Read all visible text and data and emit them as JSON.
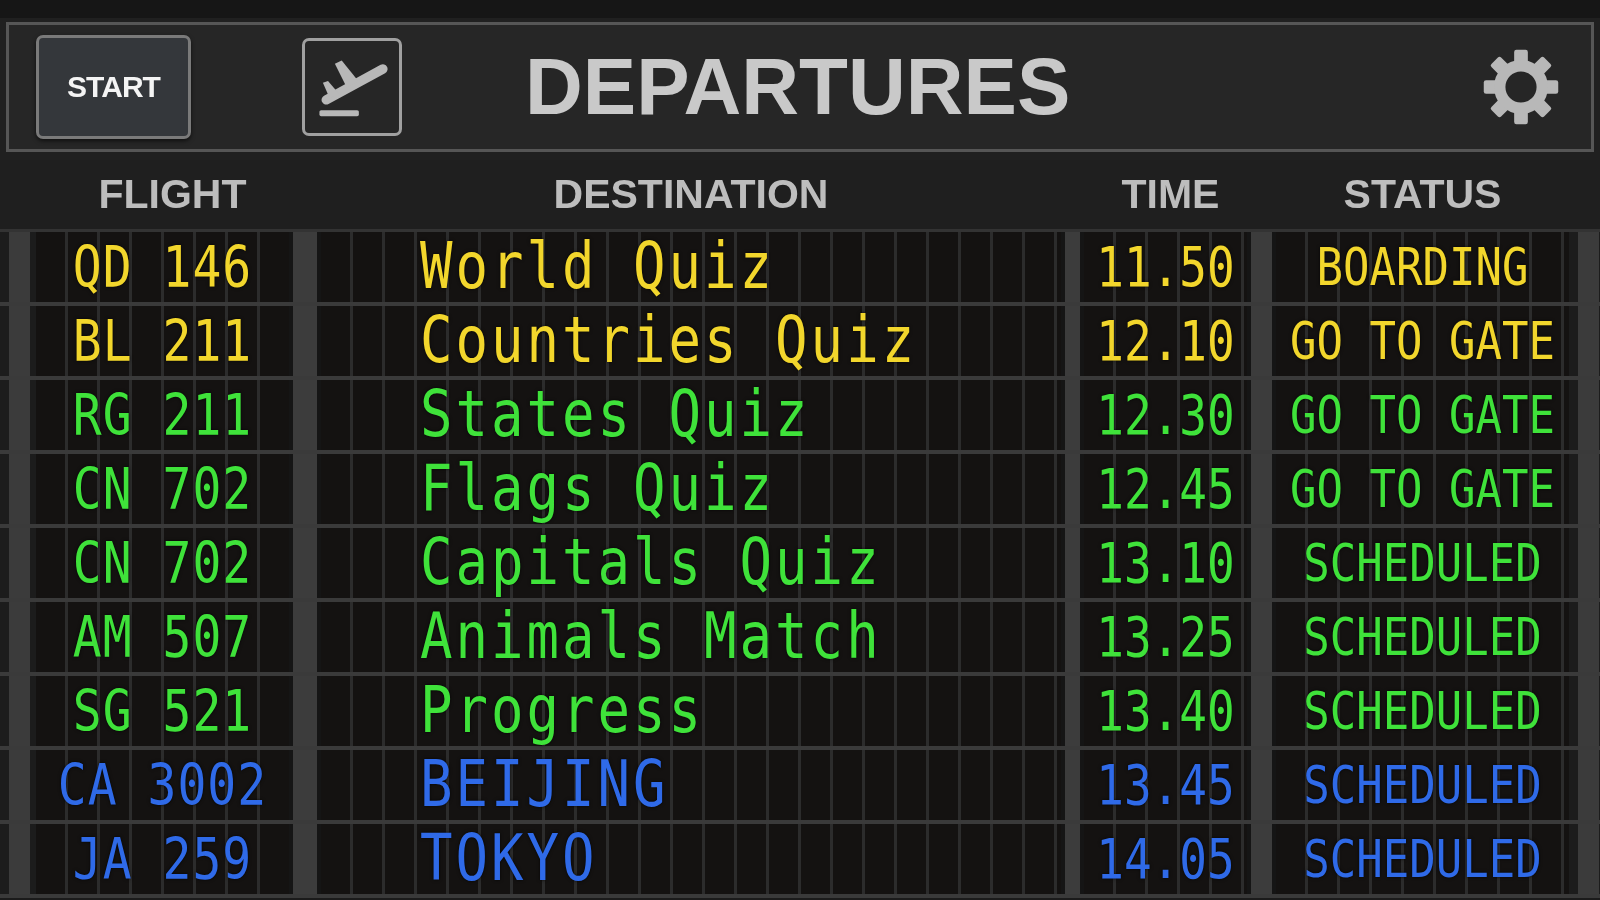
{
  "header": {
    "start_button": "START",
    "title": "DEPARTURES"
  },
  "table": {
    "columns": [
      "FLIGHT",
      "DESTINATION",
      "TIME",
      "STATUS"
    ],
    "rows": [
      {
        "flight": "QD 146",
        "destination": "World Quiz",
        "time": "11.50",
        "status": "BOARDING",
        "color": "#f2d62c"
      },
      {
        "flight": "BL 211",
        "destination": "Countries Quiz",
        "time": "12.10",
        "status": "GO TO GATE",
        "color": "#f2d62c"
      },
      {
        "flight": "RG 211",
        "destination": "States Quiz",
        "time": "12.30",
        "status": "GO TO GATE",
        "color": "#3fe23a"
      },
      {
        "flight": "CN 702",
        "destination": "Flags Quiz",
        "time": "12.45",
        "status": "GO TO GATE",
        "color": "#3fe23a"
      },
      {
        "flight": "CN 702",
        "destination": "Capitals Quiz",
        "time": "13.10",
        "status": "SCHEDULED",
        "color": "#3fe23a"
      },
      {
        "flight": "AM 507",
        "destination": "Animals Match",
        "time": "13.25",
        "status": "SCHEDULED",
        "color": "#3fe23a"
      },
      {
        "flight": "SG 521",
        "destination": "Progress",
        "time": "13.40",
        "status": "SCHEDULED",
        "color": "#3fe23a"
      },
      {
        "flight": "CA 3002",
        "destination": "BEIJING",
        "time": "13.45",
        "status": "SCHEDULED",
        "color": "#2f6ae8"
      },
      {
        "flight": "JA 259",
        "destination": "TOKYO",
        "time": "14.05",
        "status": "SCHEDULED",
        "color": "#2f6ae8"
      }
    ]
  }
}
